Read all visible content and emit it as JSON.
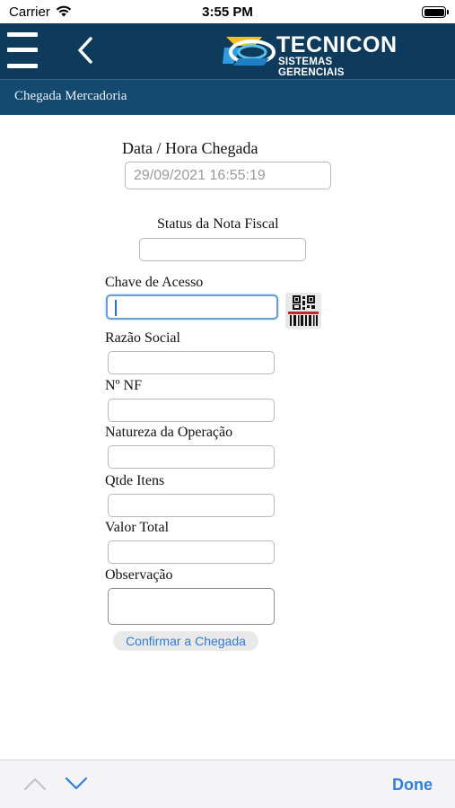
{
  "status_bar": {
    "carrier": "Carrier",
    "time": "3:55 PM"
  },
  "header": {
    "menu_icon": "hamburger-menu-icon",
    "back_icon": "chevron-left-icon",
    "logo": {
      "name": "TECNICON",
      "tagline": "SISTEMAS GERENCIAIS"
    },
    "page_title": "Chegada Mercadoria",
    "colors": {
      "appbar": "#0e3b5c",
      "subheader": "#154a70"
    }
  },
  "form": {
    "arrival": {
      "label": "Data / Hora Chegada",
      "value": "29/09/2021 16:55:19"
    },
    "invoice_status": {
      "label": "Status da Nota Fiscal",
      "value": ""
    },
    "access_key": {
      "label": "Chave de Acesso",
      "value": "",
      "scan_icon": "qr-barcode-scan-icon"
    },
    "company_name": {
      "label": "Razão Social",
      "value": ""
    },
    "invoice_number": {
      "label": "Nº NF",
      "value": ""
    },
    "operation_nature": {
      "label": "Natureza da Operação",
      "value": ""
    },
    "item_quantity": {
      "label": "Qtde Itens",
      "value": ""
    },
    "total_value": {
      "label": "Valor Total",
      "value": ""
    },
    "notes": {
      "label": "Observação",
      "value": ""
    },
    "confirm_label": "Confirmar a Chegada"
  },
  "keyboard_toolbar": {
    "previous_icon": "chevron-up-icon",
    "next_icon": "chevron-down-icon",
    "done_label": "Done",
    "accent_color": "#2f7fe1"
  }
}
